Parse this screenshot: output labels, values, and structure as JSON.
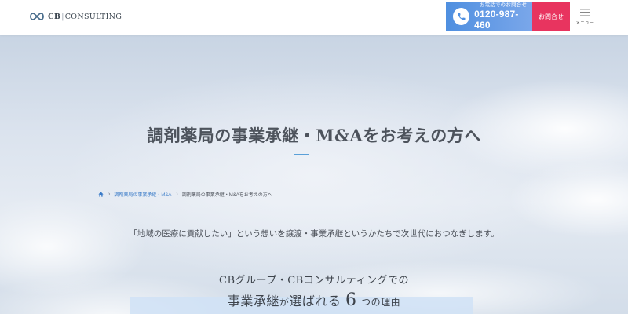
{
  "header": {
    "logo_text_cb": "CB",
    "logo_text_sep": "|",
    "logo_text_rest": "CONSULTING",
    "phone_caption": "お電話でのお問合せ",
    "phone_number": "0120-987-460",
    "contact_label": "お問合せ",
    "menu_label": "メニュー"
  },
  "hero": {
    "title": "調剤薬局の事業承継・M&Aをお考えの方へ",
    "breadcrumb": [
      {
        "label": "調剤薬局の事業承継・M&A"
      },
      {
        "label": "調剤薬局の事業承継・M&Aをお考えの方へ"
      }
    ],
    "lead": "「地域の医療に貢献したい」という想いを譲渡・事業承継というかたちで次世代におつなぎします。",
    "reasons_subtitle": "CBグループ・CBコンサルティングでの",
    "reasons_title_a": "事業承継",
    "reasons_title_b": "が",
    "reasons_title_c": "選ばれる",
    "reasons_title_num": "6",
    "reasons_title_d": "つの理由"
  },
  "colors": {
    "phone_button": "#4f8fe0",
    "contact_button": "#e8345f",
    "accent_rule": "#5aa0d8",
    "link": "#3a7bc8"
  },
  "icons": {
    "logo": "infinity-logo-icon",
    "phone": "phone-icon",
    "menu": "hamburger-icon",
    "home": "home-icon",
    "breadcrumb_separator": "chevron-right-icon"
  }
}
